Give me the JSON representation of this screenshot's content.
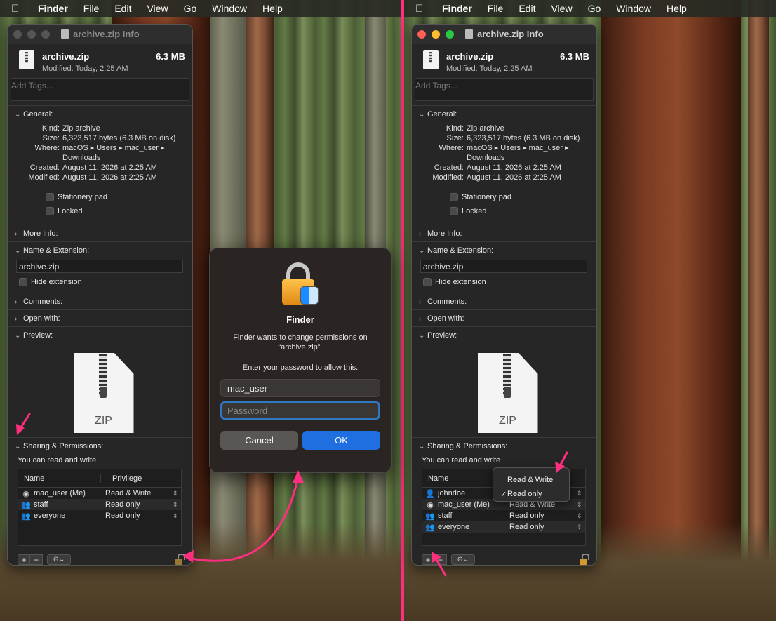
{
  "menubar": {
    "apple": "",
    "app": "Finder",
    "items": [
      "File",
      "Edit",
      "View",
      "Go",
      "Window",
      "Help"
    ]
  },
  "left_window": {
    "title": "archive.zip Info",
    "file_name": "archive.zip",
    "file_size": "6.3 MB",
    "modified": "Modified: Today, 2:25 AM",
    "tags_placeholder": "Add Tags...",
    "general": {
      "header": "General:",
      "kind_k": "Kind:",
      "kind_v": "Zip archive",
      "size_k": "Size:",
      "size_v": "6,323,517 bytes (6.3 MB on disk)",
      "where_k": "Where:",
      "where_v": "macOS ▸ Users ▸ mac_user ▸ Downloads",
      "created_k": "Created:",
      "created_v": "August 11, 2026 at 2:25 AM",
      "modified_k": "Modified:",
      "modified_v": "August 11, 2026 at 2:25 AM",
      "stationery": "Stationery pad",
      "locked": "Locked"
    },
    "more_info": "More Info:",
    "name_ext": "Name & Extension:",
    "name_value": "archive.zip",
    "hide_ext": "Hide extension",
    "comments": "Comments:",
    "open_with": "Open with:",
    "preview": "Preview:",
    "preview_label": "ZIP",
    "sharing": "Sharing & Permissions:",
    "sharing_status": "You can read and write",
    "col_name": "Name",
    "col_priv": "Privilege",
    "rows": [
      {
        "name": "mac_user (Me)",
        "priv": "Read & Write"
      },
      {
        "name": "staff",
        "priv": "Read only"
      },
      {
        "name": "everyone",
        "priv": "Read only"
      }
    ],
    "plus": "+",
    "minus": "−",
    "gear": "⊖⌄"
  },
  "auth_dialog": {
    "title": "Finder",
    "message": "Finder wants to change permissions on “archive.zip”.",
    "prompt": "Enter your password to allow this.",
    "username": "mac_user",
    "password_placeholder": "Password",
    "cancel": "Cancel",
    "ok": "OK"
  },
  "right_window": {
    "title": "archive.zip Info",
    "file_name": "archive.zip",
    "file_size": "6.3 MB",
    "modified": "Modified: Today, 2:25 AM",
    "tags_placeholder": "Add Tags...",
    "general": {
      "header": "General:",
      "kind_k": "Kind:",
      "kind_v": "Zip archive",
      "size_k": "Size:",
      "size_v": "6,323,517 bytes (6.3 MB on disk)",
      "where_k": "Where:",
      "where_v": "macOS ▸ Users ▸ mac_user ▸ Downloads",
      "created_k": "Created:",
      "created_v": "August 11, 2026 at 2:25 AM",
      "modified_k": "Modified:",
      "modified_v": "August 11, 2026 at 2:25 AM",
      "stationery": "Stationery pad",
      "locked": "Locked"
    },
    "more_info": "More Info:",
    "name_ext": "Name & Extension:",
    "name_value": "archive.zip",
    "hide_ext": "Hide extension",
    "comments": "Comments:",
    "open_with": "Open with:",
    "preview": "Preview:",
    "preview_label": "ZIP",
    "sharing": "Sharing & Permissions:",
    "sharing_status": "You can read and write",
    "col_name": "Name",
    "rows": [
      {
        "name": "johndoe",
        "priv": ""
      },
      {
        "name": "mac_user (Me)",
        "priv": "Read & Write"
      },
      {
        "name": "staff",
        "priv": "Read only"
      },
      {
        "name": "everyone",
        "priv": "Read only"
      }
    ],
    "popup": {
      "opt1": "Read & Write",
      "opt2": "Read only",
      "check": "✓"
    },
    "plus": "+",
    "minus": "−",
    "gear": "⊖⌄"
  },
  "colors": {
    "annotation": "#ff2e7e",
    "accent": "#1f6fe0"
  }
}
